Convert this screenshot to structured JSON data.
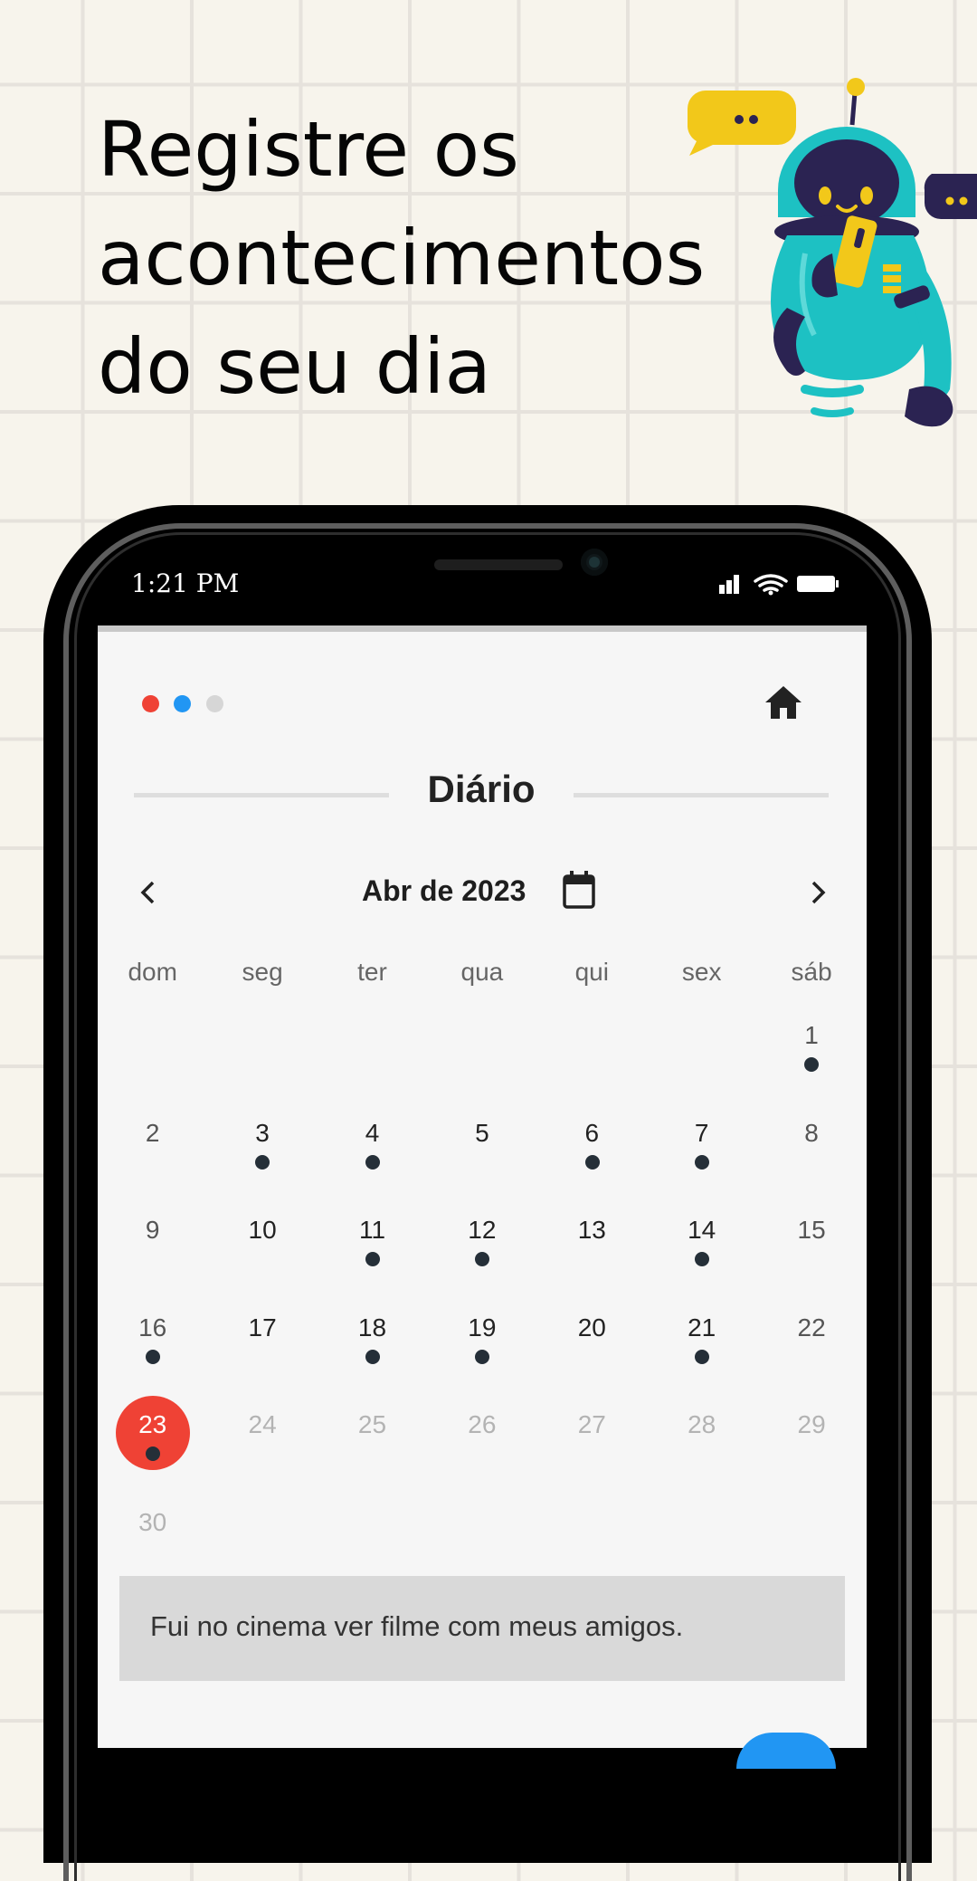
{
  "headline": [
    "Registre os",
    "acontecimentos",
    "do seu dia"
  ],
  "status_bar": {
    "time": "1:21 PM",
    "icons": [
      "signal-icon",
      "wifi-icon",
      "battery-icon"
    ]
  },
  "app": {
    "page_dots": [
      {
        "color": "#ef4235"
      },
      {
        "color": "#2196f3"
      },
      {
        "color": "#d6d6d6"
      }
    ],
    "home_icon": "home-icon",
    "title": "Diário",
    "calendar": {
      "month_label": "Abr de 2023",
      "weekdays": [
        "dom",
        "seg",
        "ter",
        "qua",
        "qui",
        "sex",
        "sáb"
      ],
      "first_weekday": 6,
      "days_in_month": 30,
      "today": 23,
      "days_with_entries": [
        1,
        3,
        4,
        6,
        7,
        11,
        12,
        14,
        16,
        18,
        19,
        21,
        23
      ]
    },
    "entry_text": "Fui no cinema ver filme com meus amigos."
  },
  "colors": {
    "accent_red": "#ef4235",
    "accent_blue": "#2196f3",
    "dot": "#252f38",
    "background": "#f7f4ec"
  }
}
